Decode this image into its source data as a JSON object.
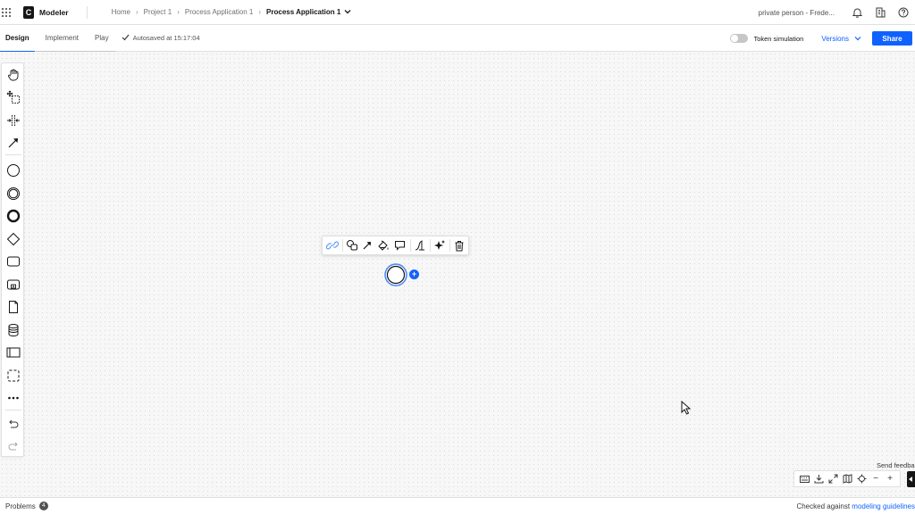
{
  "header": {
    "app_name": "Modeler",
    "logo_letter": "C",
    "breadcrumb": [
      "Home",
      "Project 1",
      "Process Application 1"
    ],
    "current": "Process Application 1",
    "user": "private person - Frede..."
  },
  "subbar": {
    "tabs": [
      {
        "label": "Design",
        "active": true
      },
      {
        "label": "Implement",
        "active": false
      },
      {
        "label": "Play",
        "active": false
      }
    ],
    "autosave": "Autosaved at 15:17:04",
    "token_simulation": "Token simulation",
    "versions": "Versions",
    "share": "Share"
  },
  "palette": {
    "icons": [
      "hand-tool-icon",
      "lasso-tool-icon",
      "space-tool-icon",
      "connect-tool-icon",
      "start-event-icon",
      "intermediate-event-icon",
      "end-event-icon",
      "gateway-icon",
      "task-icon",
      "subprocess-icon",
      "data-object-icon",
      "data-store-icon",
      "pool-icon",
      "group-icon",
      "more-icon",
      "undo-icon",
      "redo-icon"
    ]
  },
  "context_pad": {
    "icons": [
      "link-icon",
      "append-icon",
      "connect-arrow-icon",
      "color-icon",
      "comment-icon",
      "change-type-icon",
      "ai-sparkle-icon",
      "delete-icon"
    ]
  },
  "bottom": {
    "feedback": "Send feedba",
    "zoom_controls": [
      "keyboard-icon",
      "download-icon",
      "fullscreen-icon",
      "minimap-icon",
      "center-icon",
      "zoom-out-icon",
      "zoom-in-icon"
    ]
  },
  "footer": {
    "problems_label": "Problems",
    "problems_count": "4",
    "checked_prefix": "Checked against",
    "checked_link": "modeling guidelines"
  },
  "colors": {
    "accent": "#0f62fe",
    "selection": "#4589ff"
  }
}
